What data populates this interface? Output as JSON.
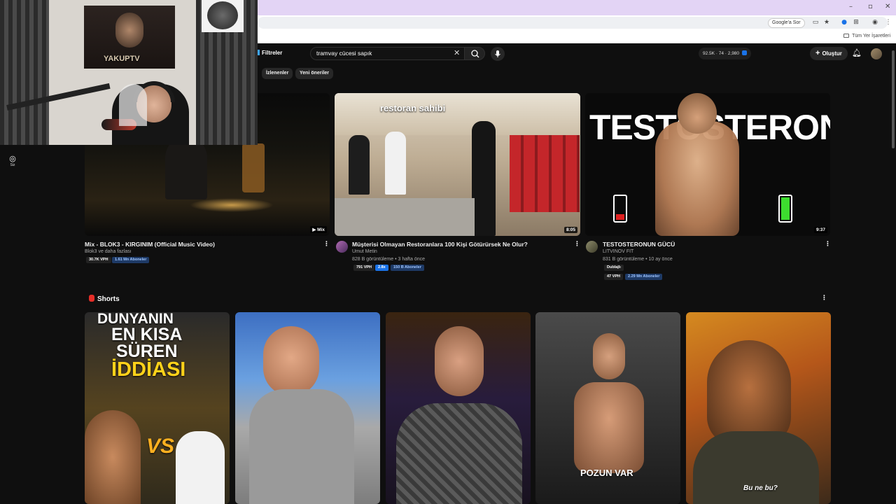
{
  "browser": {
    "google_sor": "Google'a Sor",
    "all_bookmarks": "Tüm Yer İşaretleri"
  },
  "masthead": {
    "filters_label": "Filtreler",
    "search_value": "tramvay cücesi sapık",
    "stats_text": "92.5K · 74 · 2,980",
    "create_label": "Oluştur"
  },
  "chips": [
    "İzlenenler",
    "Yeni öneriler"
  ],
  "sidebar": {
    "you_label": "Siz",
    "you_icon": "account-icon"
  },
  "videos": [
    {
      "title": "Mix - BLOK3 - KIRGINIM (Official Music Video)",
      "channel": "Blok3 ve daha fazlası",
      "badges": [
        "30.7K VPH",
        "1.61 Mn Aboneler"
      ],
      "duration": "Mix"
    },
    {
      "title": "Müşterisi Olmayan Restoranlara 100 Kişi Götürürsek Ne Olur?",
      "channel": "Umut Metin",
      "meta": "828 B görüntüleme • 3 hafta önce",
      "badges": [
        "791 VPH",
        "2.8x",
        "150 B Aboneler"
      ],
      "duration": "8:05",
      "overlay_text": "restoran sahibi"
    },
    {
      "title": "TESTOSTERONUN GÜCÜ",
      "channel": "LITVINOV FIT",
      "meta": "831 B görüntüleme • 10 ay önce",
      "tag": "Dublajlı",
      "badges": [
        "47 VPH",
        "2.29 Mn Aboneler"
      ],
      "duration": "9:37",
      "overlay_text": "TESTOSTERONE"
    }
  ],
  "shorts": {
    "heading": "Shorts",
    "items": [
      {
        "caption_lines": [
          "DÜNYANIN",
          "EN KISA",
          "SÜREN",
          "İDDİASI"
        ],
        "vs": "VS"
      },
      {
        "caption": ""
      },
      {
        "caption": ""
      },
      {
        "caption": "POZUN VAR"
      },
      {
        "caption": "Bu ne bu?"
      }
    ]
  },
  "webcam": {
    "poster_text": "YAKUPTV"
  }
}
